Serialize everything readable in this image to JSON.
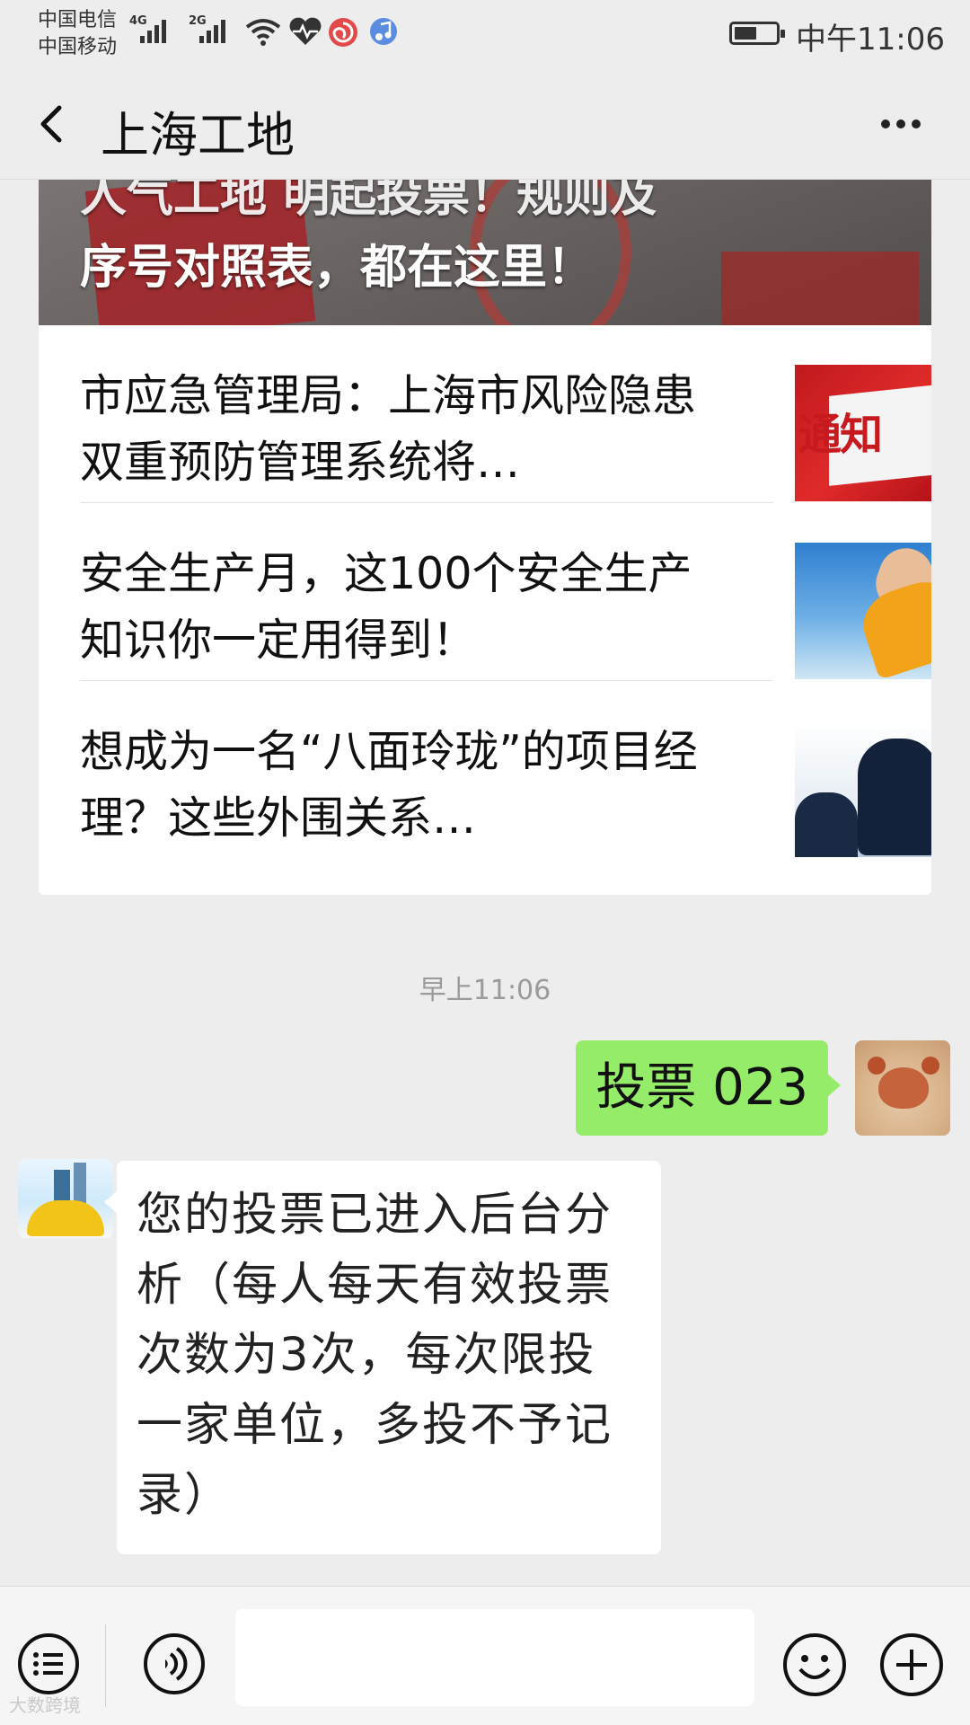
{
  "status_bar": {
    "carrier_1": "中国电信",
    "carrier_2": "中国移动",
    "signal_1_type": "4G",
    "signal_2_type": "2G",
    "time": "中午11:06",
    "battery_level": 0.55,
    "icons": [
      "signal-icon",
      "wifi-icon",
      "health-heart-icon",
      "app-spiral-icon",
      "music-app-icon",
      "battery-icon"
    ]
  },
  "header": {
    "back_icon": "chevron-left-icon",
    "title": "上海工地",
    "more_icon": "more-dots-icon"
  },
  "article_card": {
    "banner_title_cut": "人气工地 明起投票！规则及",
    "banner_title": "序号对照表，都在这里！",
    "items": [
      {
        "title": "市应急管理局：上海市风险隐患双重预防管理系统将…",
        "thumb": "通知"
      },
      {
        "title": "安全生产月，这100个安全生产知识你一定用得到！",
        "thumb": ""
      },
      {
        "title": "想成为一名“八面玲珑”的项目经理？这些外围关系…",
        "thumb": ""
      }
    ]
  },
  "timestamp": "早上11:06",
  "sent_message": {
    "text": "投票 023"
  },
  "received_message": {
    "text": "您的投票已进入后台分析（每人每天有效投票次数为3次，每次限投一家单位，多投不予记录）"
  },
  "input_bar": {
    "icons": [
      "menu-icon",
      "voice-icon",
      "emoji-icon",
      "plus-icon"
    ]
  },
  "watermark": "大数跨境"
}
